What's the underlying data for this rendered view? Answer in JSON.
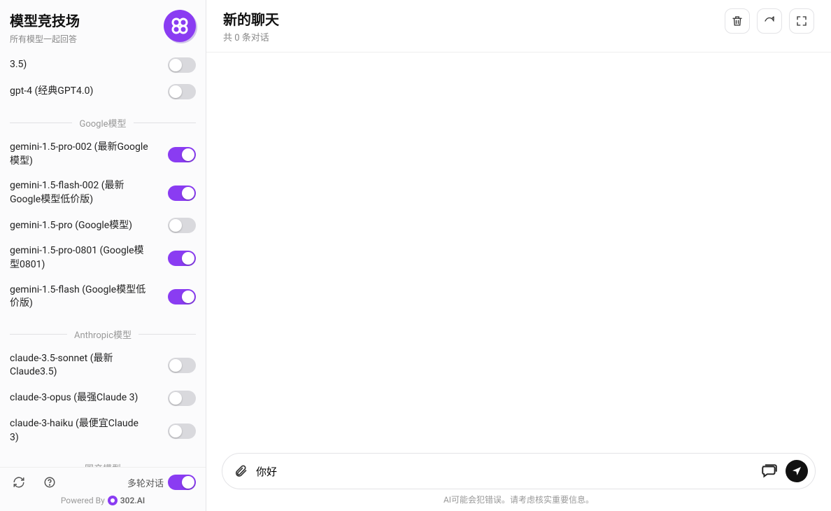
{
  "sidebar": {
    "title": "模型竞技场",
    "subtitle": "所有模型一起回答",
    "sections": [
      {
        "name": "",
        "items": [
          {
            "label": "3.5)",
            "on": false
          },
          {
            "label": "gpt-4 (经典GPT4.0)",
            "on": false
          }
        ]
      },
      {
        "name": "Google模型",
        "items": [
          {
            "label": "gemini-1.5-pro-002 (最新Google模型)",
            "on": true
          },
          {
            "label": "gemini-1.5-flash-002 (最新Google模型低价版)",
            "on": true
          },
          {
            "label": "gemini-1.5-pro (Google模型)",
            "on": false
          },
          {
            "label": "gemini-1.5-pro-0801 (Google模型0801)",
            "on": true
          },
          {
            "label": "gemini-1.5-flash (Google模型低价版)",
            "on": true
          }
        ]
      },
      {
        "name": "Anthropic模型",
        "items": [
          {
            "label": "claude-3.5-sonnet (最新Claude3.5)",
            "on": false
          },
          {
            "label": "claude-3-opus (最强Claude 3)",
            "on": false
          },
          {
            "label": "claude-3-haiku (最便宜Claude 3)",
            "on": false
          }
        ]
      },
      {
        "name": "国产模型",
        "items": []
      }
    ],
    "footer": {
      "multiturn_label": "多轮对话",
      "multiturn_on": true,
      "powered_prefix": "Powered By",
      "powered_brand": "302.AI"
    }
  },
  "main": {
    "title": "新的聊天",
    "subtitle": "共 0 条对话",
    "input_value": "你好",
    "disclaimer": "AI可能会犯错误。请考虑核实重要信息。"
  }
}
